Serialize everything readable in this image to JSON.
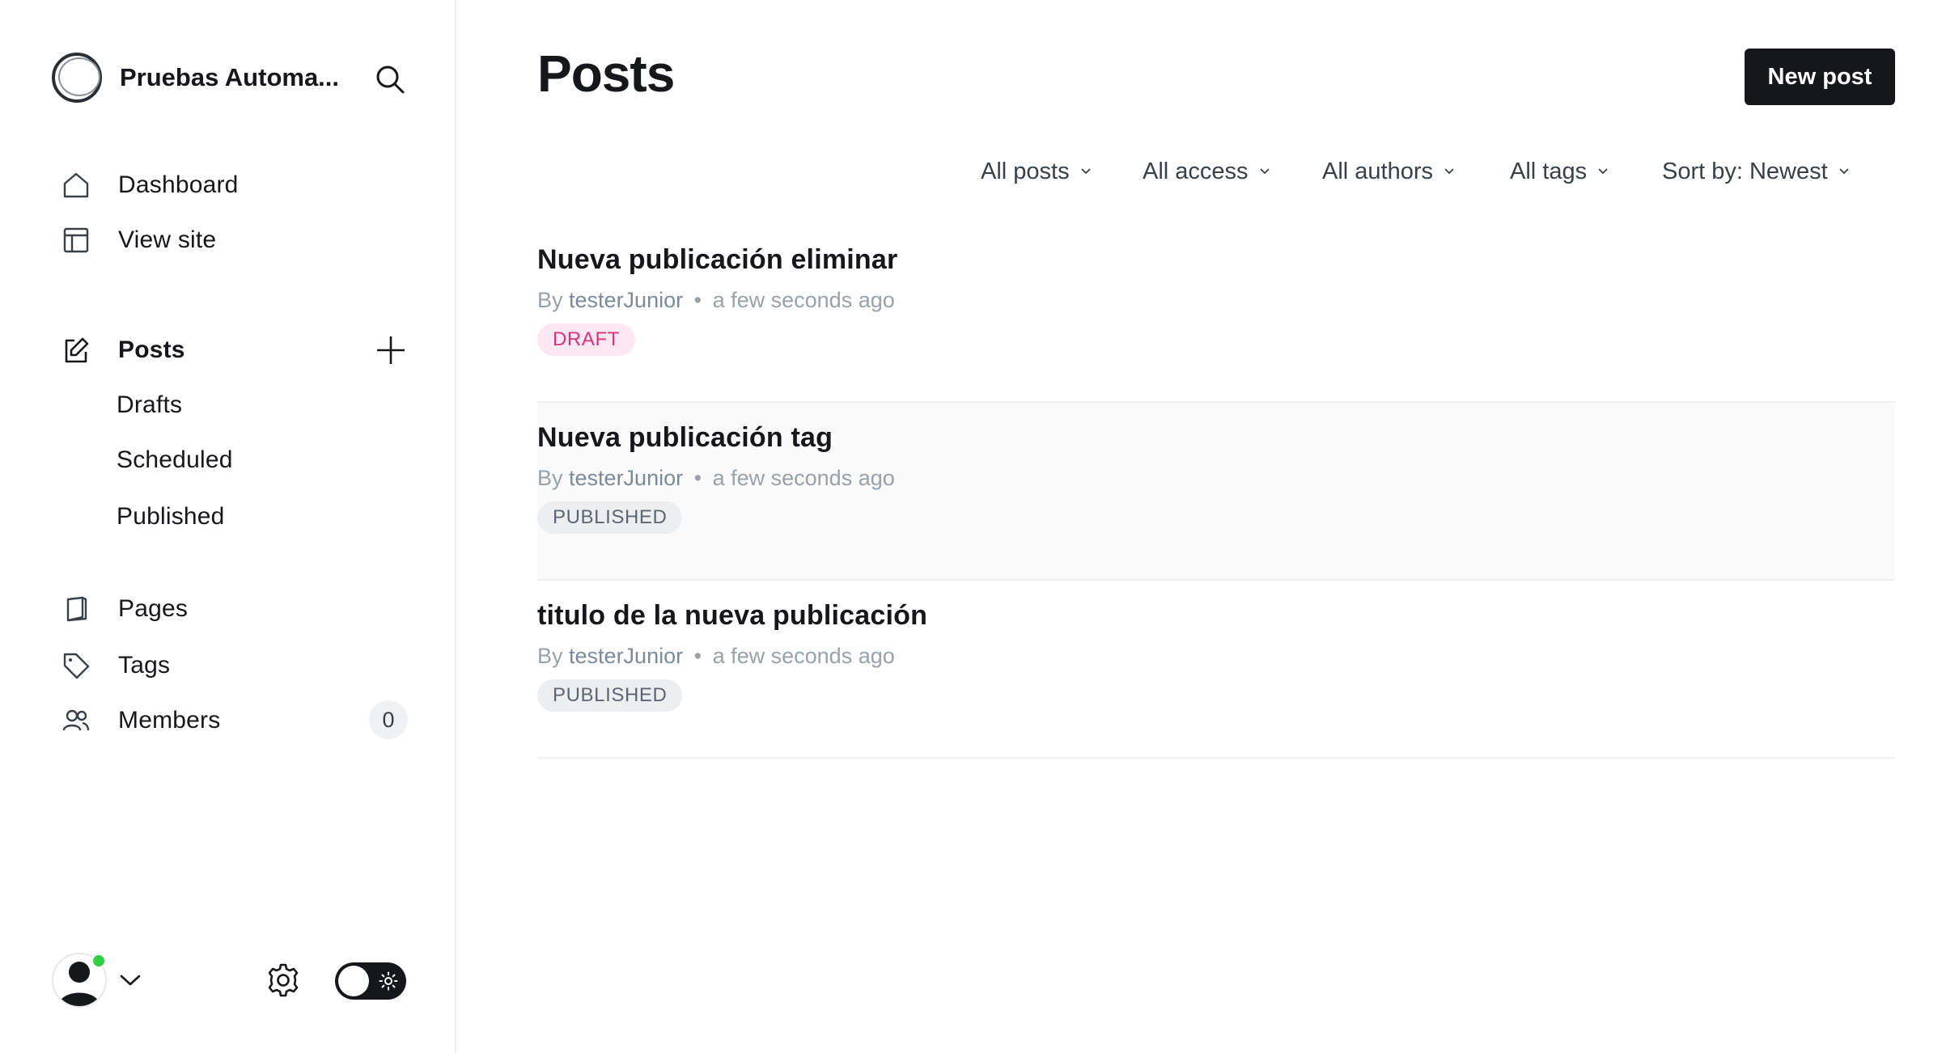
{
  "sidebar": {
    "site_name": "Pruebas Automa...",
    "nav": {
      "dashboard": "Dashboard",
      "view_site": "View site",
      "posts": "Posts",
      "drafts": "Drafts",
      "scheduled": "Scheduled",
      "published": "Published",
      "pages": "Pages",
      "tags": "Tags",
      "members": "Members",
      "members_count": "0"
    }
  },
  "main": {
    "title": "Posts",
    "new_post_label": "New post",
    "filters": {
      "type": "All posts",
      "access": "All access",
      "authors": "All authors",
      "tags": "All tags",
      "sort": "Sort by: Newest"
    },
    "posts": [
      {
        "title": "Nueva publicación eliminar",
        "by": "By",
        "author": "testerJunior",
        "time": "a few seconds ago",
        "status": "DRAFT"
      },
      {
        "title": "Nueva publicación tag",
        "by": "By",
        "author": "testerJunior",
        "time": "a few seconds ago",
        "status": "PUBLISHED"
      },
      {
        "title": "titulo de la nueva publicación",
        "by": "By",
        "author": "testerJunior",
        "time": "a few seconds ago",
        "status": "PUBLISHED"
      }
    ]
  },
  "colors": {
    "primary": "#15171a",
    "draft_text": "#d6347b",
    "draft_bg": "#fde8f1",
    "published_bg": "#eceef0",
    "online_dot": "#30cf43"
  },
  "icons": [
    "brand-logo",
    "search-icon",
    "home-icon",
    "view-site-icon",
    "edit-icon",
    "plus-icon",
    "page-icon",
    "tag-icon",
    "members-icon",
    "user-avatar",
    "chevron-down-icon",
    "gear-icon",
    "sun-icon"
  ]
}
